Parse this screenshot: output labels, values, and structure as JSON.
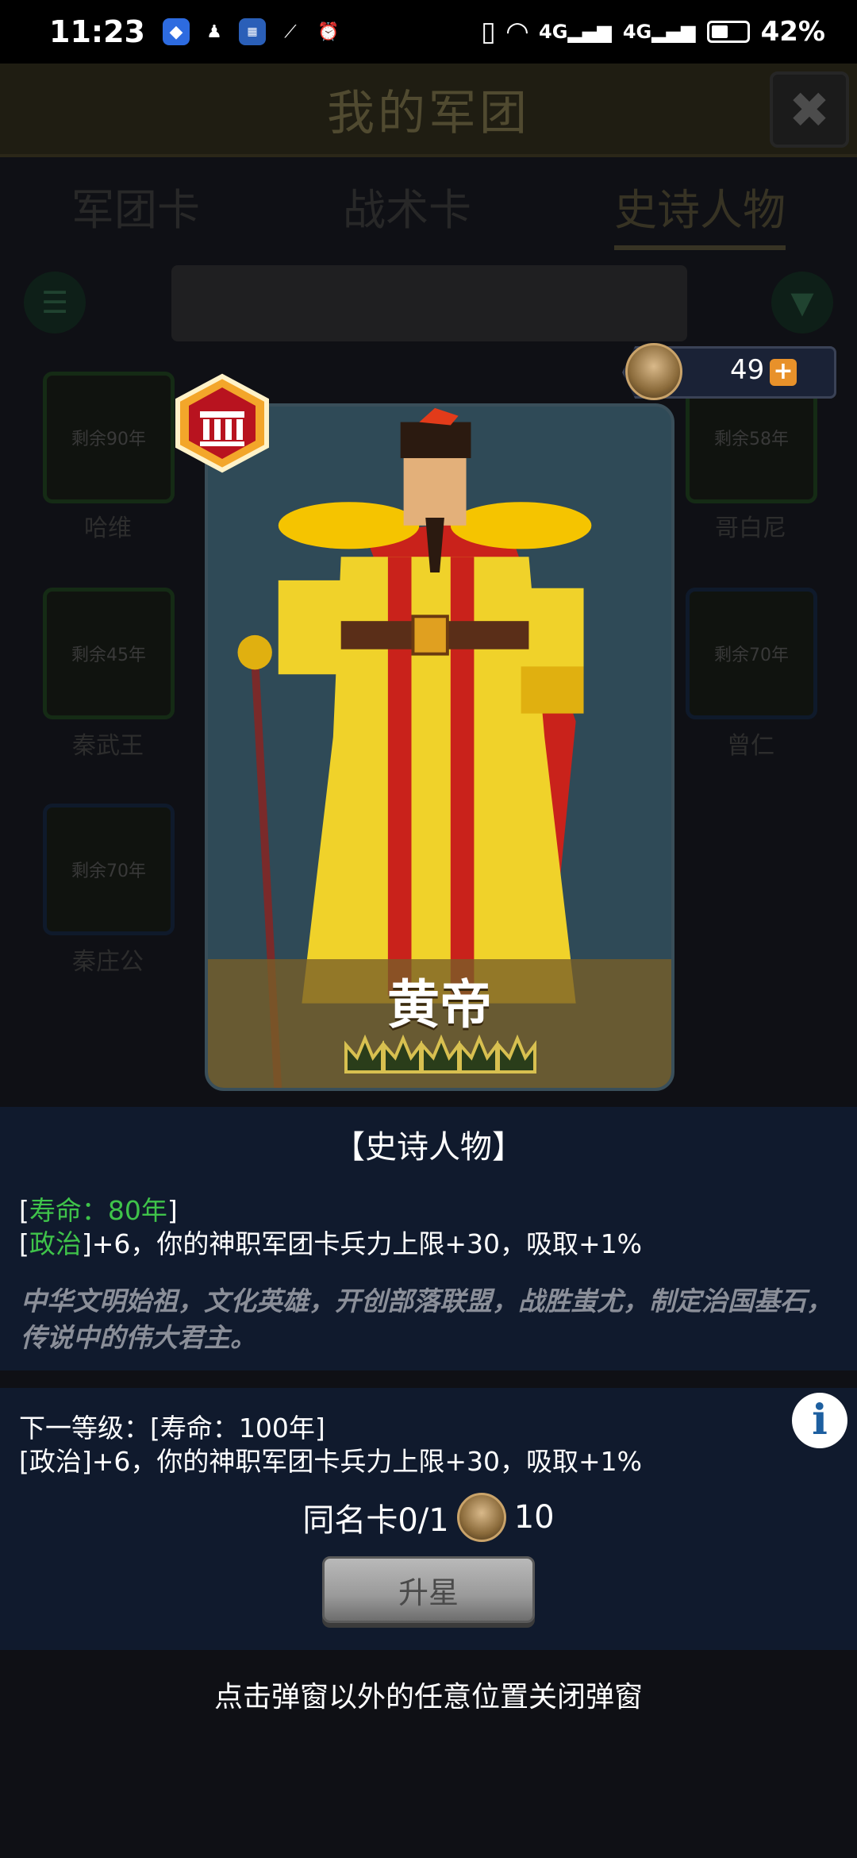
{
  "status_bar": {
    "time": "11:23",
    "battery": "42%",
    "icons": [
      "shield-icon",
      "qq-icon",
      "app-icon",
      "link-icon",
      "alarm-icon",
      "vibrate-icon",
      "wifi-icon",
      "signal-4g-icon",
      "signal-4g-icon-2",
      "battery-icon"
    ]
  },
  "header": {
    "title": "我的军团",
    "close_label": "✖"
  },
  "tabs": [
    "军团卡",
    "战术卡",
    "史诗人物"
  ],
  "active_tab": "史诗人物",
  "background_cards": [
    {
      "label": "剩余90年",
      "name": "哈维"
    },
    {
      "label": "剩余58年",
      "name": "哥白尼"
    },
    {
      "label": "剩余45年",
      "name": "秦武王"
    },
    {
      "label": "剩余70年",
      "name": "曾仁"
    },
    {
      "label": "剩余70年",
      "name": "秦庄公"
    }
  ],
  "currency": {
    "value": "49",
    "plus": "+"
  },
  "card": {
    "name": "黄帝",
    "stars": 5,
    "colors": {
      "robe": "#f0d22a",
      "red": "#c9221b",
      "band": "#7a6028"
    }
  },
  "info": {
    "category": "【史诗人物】",
    "lifespan_prefix": "[",
    "lifespan": "寿命：80年",
    "lifespan_suffix": "]",
    "politics_prefix": "[",
    "politics": "政治",
    "effect": "]+6，你的神职军团卡兵力上限+30，吸取+1%",
    "description": "中华文明始祖，文化英雄，开创部落联盟，战胜蚩尤，制定治国基石，传说中的伟大君主。"
  },
  "next_level": {
    "line1": "下一等级：[寿命：100年]",
    "line2": "[政治]+6，你的神职军团卡兵力上限+30，吸取+1%",
    "info_icon": "i"
  },
  "same_card": {
    "label": "同名卡0/1",
    "cost": "10"
  },
  "upgrade_button": "升星",
  "hint": "点击弹窗以外的任意位置关闭弹窗"
}
